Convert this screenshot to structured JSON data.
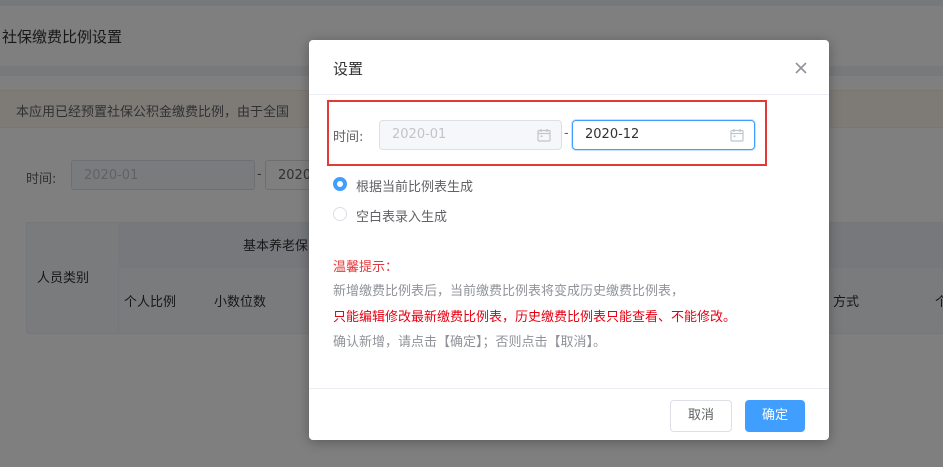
{
  "background": {
    "page_title": "社保缴费比例设置",
    "notice": "本应用已经预置社保公积金缴费比例，由于全国",
    "filter_label": "时间:",
    "filter_start": "2020-01",
    "filter_end": "2020",
    "table": {
      "col_person_type": "人员类别",
      "group_pension": "基本养老保",
      "col_personal_ratio": "个人比例",
      "col_decimals": "小数位数",
      "col_method": "方式",
      "col_edge": "个"
    }
  },
  "dialog": {
    "title": "设置",
    "time_label": "时间:",
    "start_date": "2020-01",
    "range_separator": "-",
    "end_date": "2020-12",
    "radio_options": [
      {
        "label": "根据当前比例表生成",
        "checked": true
      },
      {
        "label": "空白表录入生成",
        "checked": false
      }
    ],
    "tips": {
      "title": "温馨提示：",
      "line1": "新增缴费比例表后，当前缴费比例表将变成历史缴费比例表，",
      "line2": "只能编辑修改最新缴费比例表，历史缴费比例表只能查看、不能修改。",
      "line3": "确认新增，请点击【确定】；否则点击【取消】。"
    },
    "cancel_label": "取消",
    "confirm_label": "确定"
  },
  "icons": {
    "close": "close-icon",
    "calendar": "calendar-icon"
  },
  "colors": {
    "primary": "#409eff",
    "highlight_border": "#e53935",
    "warning_text": "#e60012"
  }
}
